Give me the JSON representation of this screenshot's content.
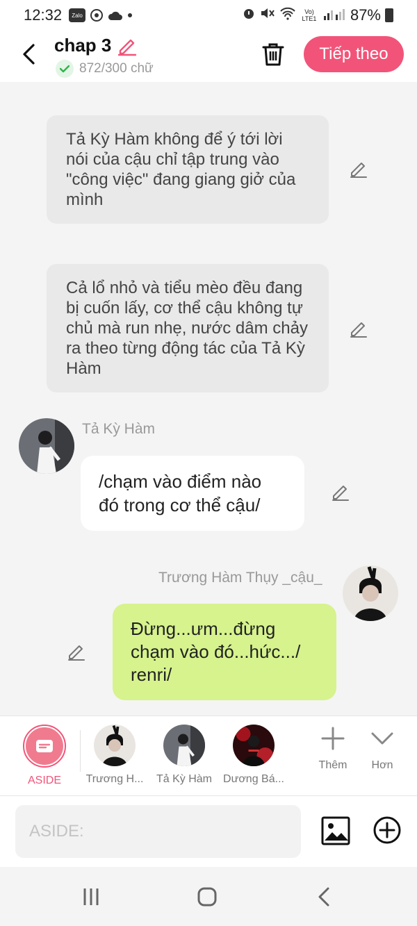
{
  "status": {
    "time": "12:32",
    "battery": "87%",
    "net_label": "Vo) LTE1"
  },
  "header": {
    "title": "chap 3",
    "word_count": "872/300 chữ",
    "next_label": "Tiếp theo"
  },
  "messages": {
    "aside1": "Tả Kỳ Hàm không để ý tới lời nói của cậu chỉ tập trung vào \"công việc\" đang giang giở của mình",
    "aside2": "Cả lổ nhỏ và tiểu mèo đều đang bị cuốn lấy, cơ thể cậu không tự chủ mà run nhẹ, nước dâm chảy ra theo từng động tác của Tả Kỳ Hàm",
    "left_name": "Tả Kỳ Hàm",
    "left_text": "/chạm vào điểm nào đó trong cơ thể cậu/",
    "right_name": "Trương Hàm Thụy _cậu_",
    "right_text": "Đừng...ưm...đừng chạm vào đó...hức.../ renri/"
  },
  "characters": {
    "aside_label": "ASIDE",
    "char1": "Trương H...",
    "char2": "Tả Kỳ Hàm",
    "char3": "Dương Bá...",
    "more_label": "Thêm",
    "hon_label": "Hơn"
  },
  "input": {
    "placeholder": "ASIDE:"
  },
  "colors": {
    "accent": "#f25479",
    "bubble_right": "#d6f38d",
    "aside_bubble": "#e9e9e9"
  }
}
